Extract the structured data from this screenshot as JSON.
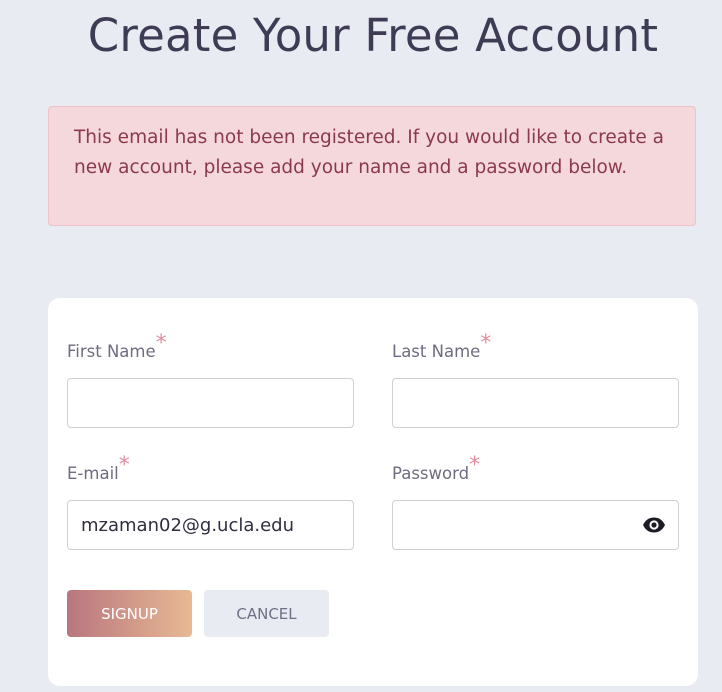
{
  "page": {
    "title": "Create Your Free Account"
  },
  "alert": {
    "message": "This email has not been registered. If you would like to create a new account, please add your name and a password below."
  },
  "form": {
    "first_name": {
      "label": "First Name",
      "required_mark": "*",
      "value": ""
    },
    "last_name": {
      "label": "Last Name",
      "required_mark": "*",
      "value": ""
    },
    "email": {
      "label": "E-mail",
      "required_mark": "*",
      "value": "mzaman02@g.ucla.edu"
    },
    "password": {
      "label": "Password",
      "required_mark": "*",
      "value": ""
    },
    "password_toggle_icon": "eye-icon"
  },
  "buttons": {
    "signup_label": "SIGNUP",
    "cancel_label": "CANCEL"
  },
  "colors": {
    "background": "#e9ebf2",
    "alert_background": "#f5d8dc",
    "alert_text": "#8a3a4a",
    "required_mark": "#e28f9f",
    "signup_gradient_start": "#b9767e",
    "signup_gradient_end": "#e8b994"
  }
}
